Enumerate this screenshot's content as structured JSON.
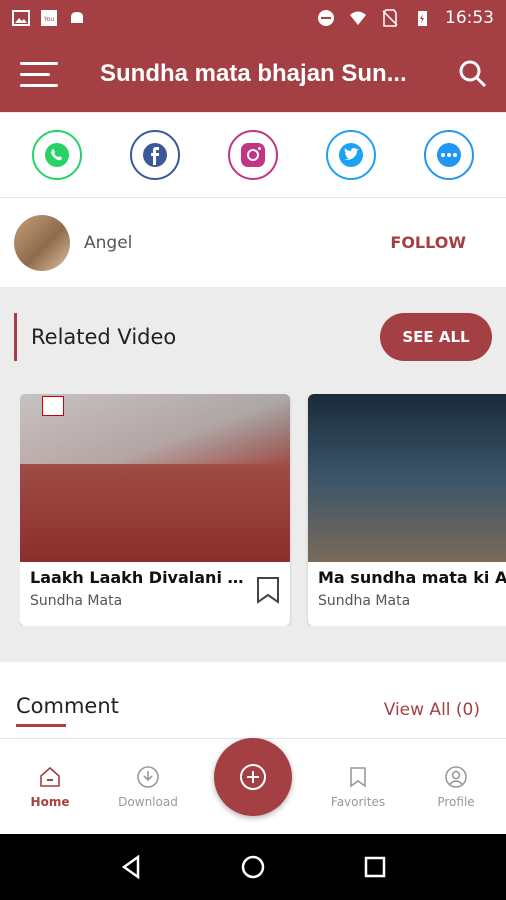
{
  "status_bar": {
    "time": "16:53",
    "left_icons": [
      "image-icon",
      "app-icon",
      "android-icon"
    ],
    "right_icons": [
      "do-not-disturb-icon",
      "wifi-icon",
      "no-sim-icon",
      "battery-charging-icon"
    ]
  },
  "app_bar": {
    "title": "Sundha mata bhajan Sun..."
  },
  "share": {
    "items": [
      {
        "name": "whatsapp",
        "icon": "whatsapp-icon",
        "color": "#25d366"
      },
      {
        "name": "facebook",
        "icon": "facebook-icon",
        "color": "#3b5998"
      },
      {
        "name": "instagram",
        "icon": "instagram-icon",
        "color": "#c13584"
      },
      {
        "name": "twitter",
        "icon": "twitter-icon",
        "color": "#1da1f2"
      },
      {
        "name": "more",
        "icon": "more-icon",
        "color": "#2196f3"
      }
    ]
  },
  "author": {
    "name": "Angel",
    "follow_label": "FOLLOW"
  },
  "related": {
    "title": "Related Video",
    "see_all_label": "SEE ALL",
    "videos": [
      {
        "title": "Laakh Laakh Divalani Aa...",
        "channel": "Sundha Mata"
      },
      {
        "title": "Ma sundha mata ki Aa",
        "channel": "Sundha Mata"
      }
    ]
  },
  "comments": {
    "title": "Comment",
    "view_all_label": "View All (0)"
  },
  "bottom_nav": {
    "items": [
      {
        "label": "Home",
        "icon": "home-icon",
        "active": true
      },
      {
        "label": "Download",
        "icon": "download-icon",
        "active": false
      },
      {
        "label": "Favorites",
        "icon": "bookmark-icon",
        "active": false
      },
      {
        "label": "Profile",
        "icon": "profile-icon",
        "active": false
      }
    ],
    "fab_icon": "add-icon"
  },
  "colors": {
    "accent": "#a43f44",
    "background": "#ececec"
  }
}
